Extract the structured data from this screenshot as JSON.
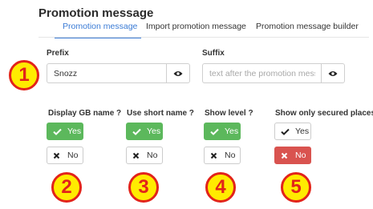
{
  "page_title": "Promotion message",
  "tabs": [
    {
      "label": "Promotion message",
      "active": true
    },
    {
      "label": "Import promotion message",
      "active": false
    },
    {
      "label": "Promotion message builder",
      "active": false
    }
  ],
  "prefix": {
    "label": "Prefix",
    "value": "Snozz",
    "placeholder": ""
  },
  "suffix": {
    "label": "Suffix",
    "value": "",
    "placeholder": "text after the promotion message"
  },
  "options": [
    {
      "question": "Display GB name ?",
      "yes_label": "Yes",
      "no_label": "No",
      "selected": "yes"
    },
    {
      "question": "Use short name ?",
      "yes_label": "Yes",
      "no_label": "No",
      "selected": "yes"
    },
    {
      "question": "Show level ?",
      "yes_label": "Yes",
      "no_label": "No",
      "selected": "yes"
    },
    {
      "question": "Show only secured places",
      "yes_label": "Yes",
      "no_label": "No",
      "selected": "no"
    }
  ],
  "badges": [
    "1",
    "2",
    "3",
    "4",
    "5"
  ],
  "colors": {
    "accent": "#3a7bd5",
    "yes_active": "#5cb85c",
    "no_active": "#d9534f",
    "badge_fill": "#ffeb00",
    "badge_ring": "#e2231a"
  },
  "icons": {
    "visibility": "eye-icon",
    "yes": "check-icon",
    "no": "close-icon"
  }
}
